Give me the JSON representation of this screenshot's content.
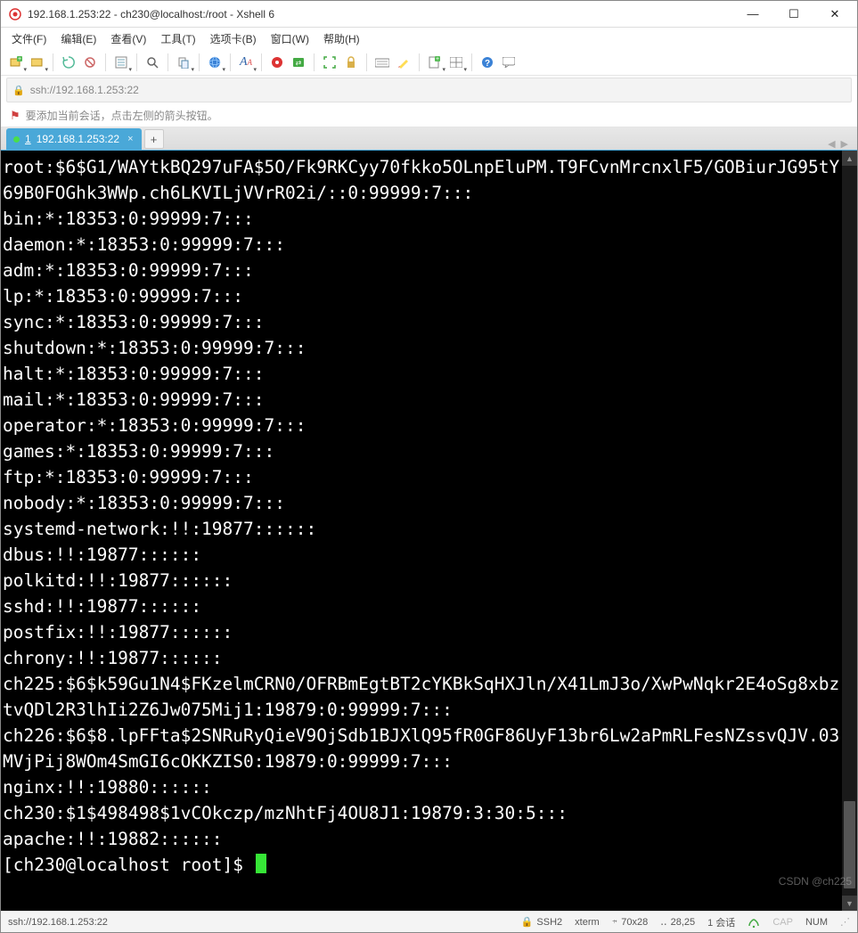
{
  "window": {
    "title": "192.168.1.253:22 - ch230@localhost:/root - Xshell 6"
  },
  "menu": {
    "items": [
      "文件(F)",
      "编辑(E)",
      "查看(V)",
      "工具(T)",
      "选项卡(B)",
      "窗口(W)",
      "帮助(H)"
    ]
  },
  "address": {
    "url": "ssh://192.168.1.253:22"
  },
  "infobar": {
    "text": "要添加当前会话，点击左侧的箭头按钮。"
  },
  "tab": {
    "num": "1",
    "label": "192.168.1.253:22"
  },
  "terminal": {
    "lines": [
      "root:$6$G1/WAYtkBQ297uFA$5O/Fk9RKCyy70fkko5OLnpEluPM.T9FCvnMrcnxlF5/GOBiurJG95tY69B0FOGhk3WWp.ch6LKVILjVVrR02i/::0:99999:7:::",
      "bin:*:18353:0:99999:7:::",
      "daemon:*:18353:0:99999:7:::",
      "adm:*:18353:0:99999:7:::",
      "lp:*:18353:0:99999:7:::",
      "sync:*:18353:0:99999:7:::",
      "shutdown:*:18353:0:99999:7:::",
      "halt:*:18353:0:99999:7:::",
      "mail:*:18353:0:99999:7:::",
      "operator:*:18353:0:99999:7:::",
      "games:*:18353:0:99999:7:::",
      "ftp:*:18353:0:99999:7:::",
      "nobody:*:18353:0:99999:7:::",
      "systemd-network:!!:19877::::::",
      "dbus:!!:19877::::::",
      "polkitd:!!:19877::::::",
      "sshd:!!:19877::::::",
      "postfix:!!:19877::::::",
      "chrony:!!:19877::::::",
      "ch225:$6$k59Gu1N4$FKzelmCRN0/OFRBmEgtBT2cYKBkSqHXJln/X41LmJ3o/XwPwNqkr2E4oSg8xbztvQDl2R3lhIi2Z6Jw075Mij1:19879:0:99999:7:::",
      "ch226:$6$8.lpFFta$2SNRuRyQieV9OjSdb1BJXlQ95fR0GF86UyF13br6Lw2aPmRLFesNZssvQJV.03MVjPij8WOm4SmGI6cOKKZIS0:19879:0:99999:7:::",
      "nginx:!!:19880::::::",
      "ch230:$1$498498$1vCOkczp/mzNhtFj4OU8J1:19879:3:30:5:::",
      "apache:!!:19882::::::"
    ],
    "prompt": "[ch230@localhost root]$ "
  },
  "status": {
    "left": "ssh://192.168.1.253:22",
    "ssh": "SSH2",
    "term": "xterm",
    "size": "70x28",
    "pos": "28,25",
    "sessions": "1 会话",
    "cap": "CAP",
    "num": "NUM"
  },
  "watermark": "CSDN @ch225"
}
